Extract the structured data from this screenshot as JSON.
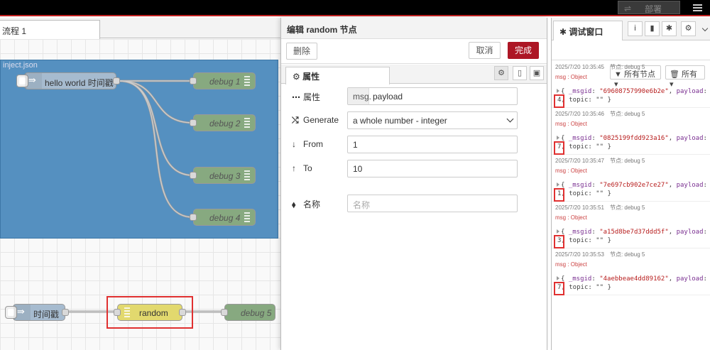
{
  "header": {
    "deploy_label": "部署"
  },
  "workspace": {
    "flow_tab": "流程 1",
    "group_label": "inject.json",
    "nodes": {
      "inject1": "hello world 时间戳",
      "debug1": "debug 1",
      "debug2": "debug 2",
      "debug3": "debug 3",
      "debug4": "debug 4",
      "inject2": "时间戳",
      "random": "random",
      "debug5": "debug 5"
    }
  },
  "editor": {
    "title": "编辑 random 节点",
    "delete_label": "删除",
    "cancel_label": "取消",
    "done_label": "完成",
    "properties_tab": "属性",
    "fields": {
      "property_label": "属性",
      "property_prefix": "msg.",
      "property_value": "payload",
      "generate_label": "Generate",
      "generate_value": "a whole number - integer",
      "from_label": "From",
      "from_value": "1",
      "to_label": "To",
      "to_value": "10",
      "name_label": "名称",
      "name_placeholder": "名称"
    }
  },
  "sidebar": {
    "tab_label": "调试窗口",
    "filter_nodes": "所有节点",
    "clear_label": "所有",
    "messages": [
      {
        "time": "2025/7/20 10:35:45",
        "node": "节点: debug 5",
        "type": "msg : Object",
        "msgid": "69608757990e6b2e",
        "payload": "4"
      },
      {
        "time": "2025/7/20 10:35:46",
        "node": "节点: debug 5",
        "type": "msg : Object",
        "msgid": "0825199fdd923a16",
        "payload": "7"
      },
      {
        "time": "2025/7/20 10:35:47",
        "node": "节点: debug 5",
        "type": "msg : Object",
        "msgid": "7e697cb902e7ce27",
        "payload": "1"
      },
      {
        "time": "2025/7/20 10:35:51",
        "node": "节点: debug 5",
        "type": "msg : Object",
        "msgid": "a15d8be7d37ddd5f",
        "payload": "3"
      },
      {
        "time": "2025/7/20 10:35:53",
        "node": "节点: debug 5",
        "type": "msg : Object",
        "msgid": "4aebbeae4dd89162",
        "payload": "7"
      }
    ]
  }
}
